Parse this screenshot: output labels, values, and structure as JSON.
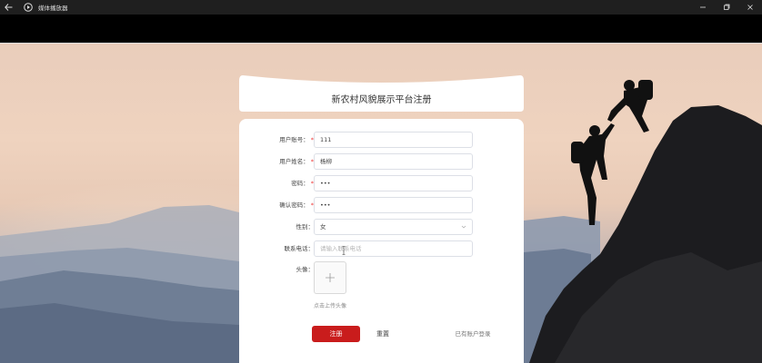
{
  "window": {
    "title": "媒体播放器",
    "back_icon": "arrow-left-icon",
    "app_icon": "play-circle-icon",
    "controls": [
      "minimize-icon",
      "maximize-icon",
      "close-icon"
    ]
  },
  "header": {
    "title": "新农村风貌展示平台注册"
  },
  "form": {
    "username": {
      "label": "用户账号：",
      "required": "*",
      "value": "111"
    },
    "realname": {
      "label": "用户姓名：",
      "required": "*",
      "value": "杨柳"
    },
    "password": {
      "label": "密码：",
      "required": "*",
      "value": "•••"
    },
    "confirm_password": {
      "label": "确认密码：",
      "required": "*",
      "value": "•••"
    },
    "gender": {
      "label": "性别：",
      "value": "女"
    },
    "phone": {
      "label": "联系电话：",
      "placeholder": "请输入联系电话"
    },
    "avatar": {
      "label": "头像：",
      "plus": "+",
      "hint": "点击上传头像"
    }
  },
  "actions": {
    "register": "注册",
    "reset": "重置",
    "login_link": "已有账户登录"
  },
  "colors": {
    "primary": "#c91c1c",
    "required": "#e33333",
    "titlebar": "#1f1f1f"
  }
}
